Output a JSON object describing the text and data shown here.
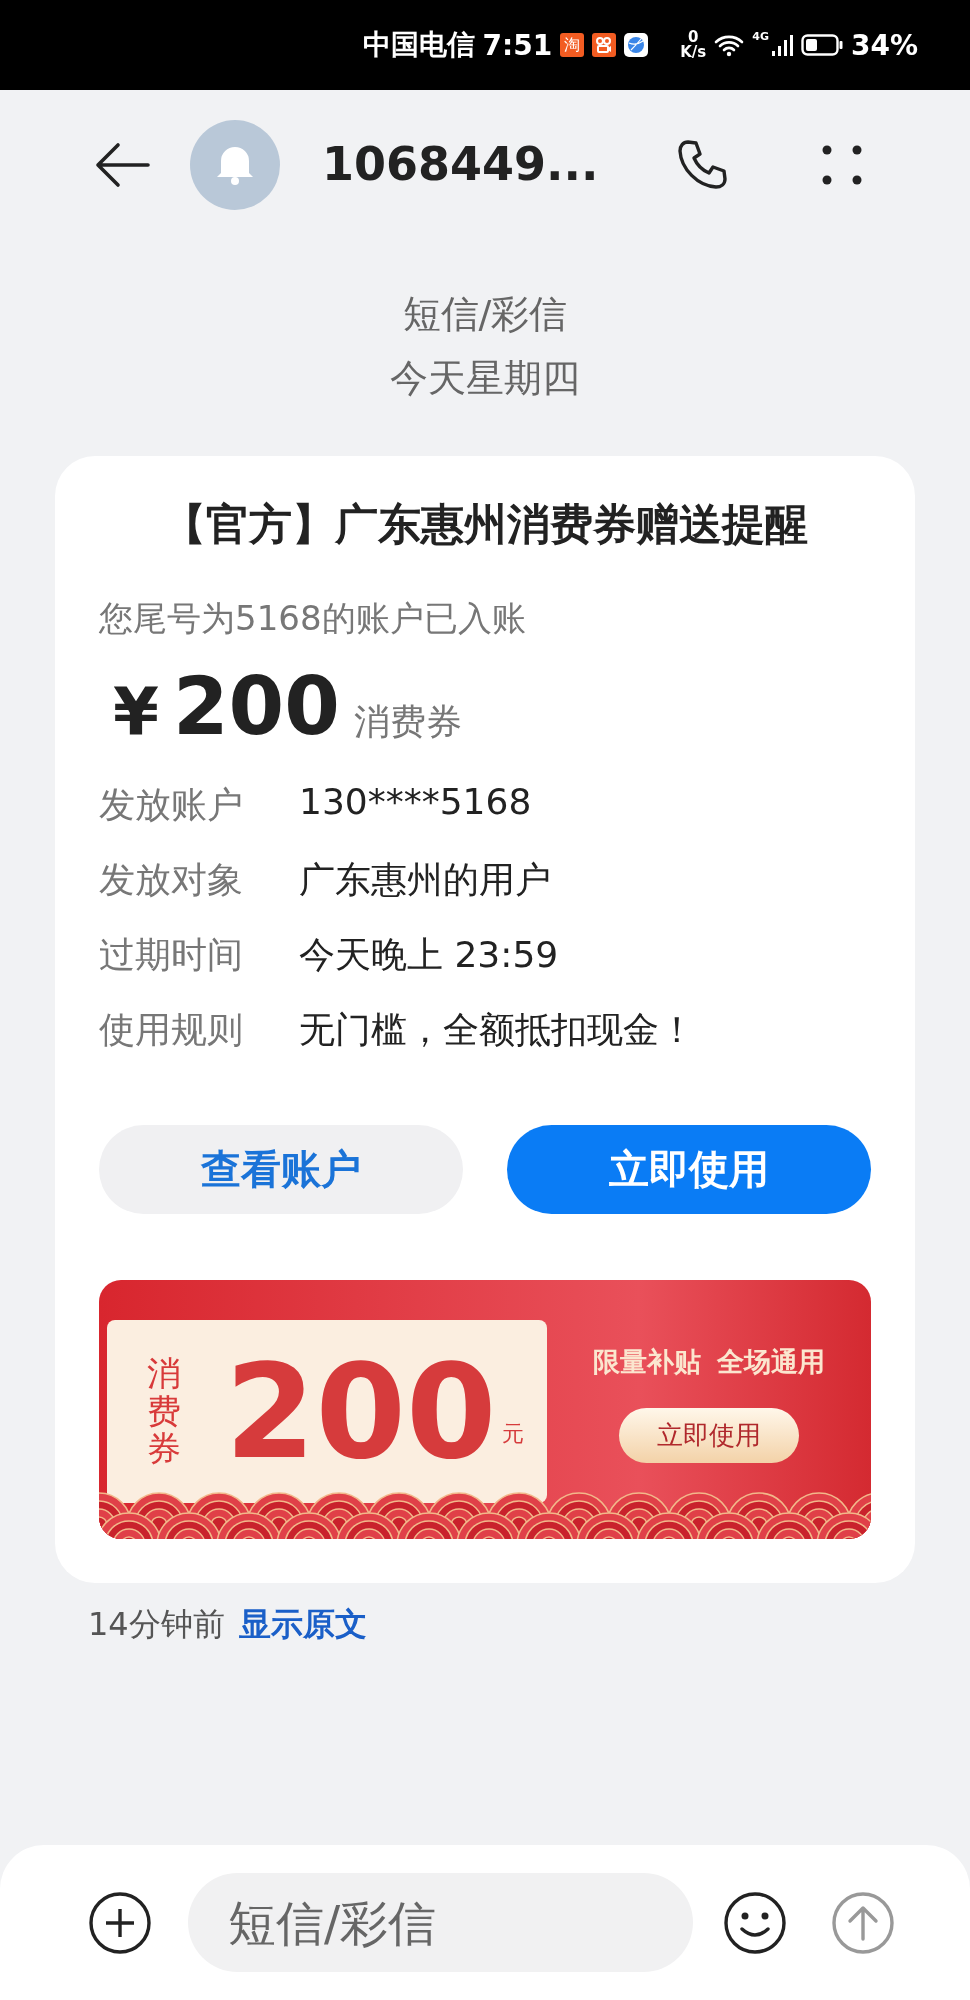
{
  "status_bar": {
    "carrier": "中国电信",
    "time": "7:51",
    "notifications": [
      {
        "kind": "shop",
        "glyph": "淘"
      },
      {
        "kind": "video"
      },
      {
        "kind": "browser"
      }
    ],
    "net_speed": "0",
    "net_unit": "K/s",
    "network": "4G",
    "battery": "34%"
  },
  "header": {
    "title": "1068449..."
  },
  "thread_info": {
    "channel": "短信/彩信",
    "date": "今天星期四"
  },
  "message": {
    "title": "【官方】广东惠州消费券赠送提醒",
    "notice": "您尾号为5168的账户已入账",
    "currency": "¥",
    "amount": "200",
    "amount_unit": "消费券",
    "details": [
      {
        "label": "发放账户",
        "value": "130****5168"
      },
      {
        "label": "发放对象",
        "value": "广东惠州的用户"
      },
      {
        "label": "过期时间",
        "value": "今天晚上 23:59"
      },
      {
        "label": "使用规则",
        "value": "无门槛，全额抵扣现金！"
      }
    ],
    "buttons": [
      {
        "label": "查看账户",
        "kind": "secondary"
      },
      {
        "label": "立即使用",
        "kind": "primary"
      }
    ],
    "banner": {
      "tag": "消费券",
      "amount": "200",
      "unit": "元",
      "slogans": [
        "限量补贴",
        "全场通用"
      ],
      "button": "立即使用"
    }
  },
  "meta": {
    "time": "14分钟前",
    "link": "显示原文"
  },
  "composer": {
    "placeholder": "短信/彩信"
  }
}
